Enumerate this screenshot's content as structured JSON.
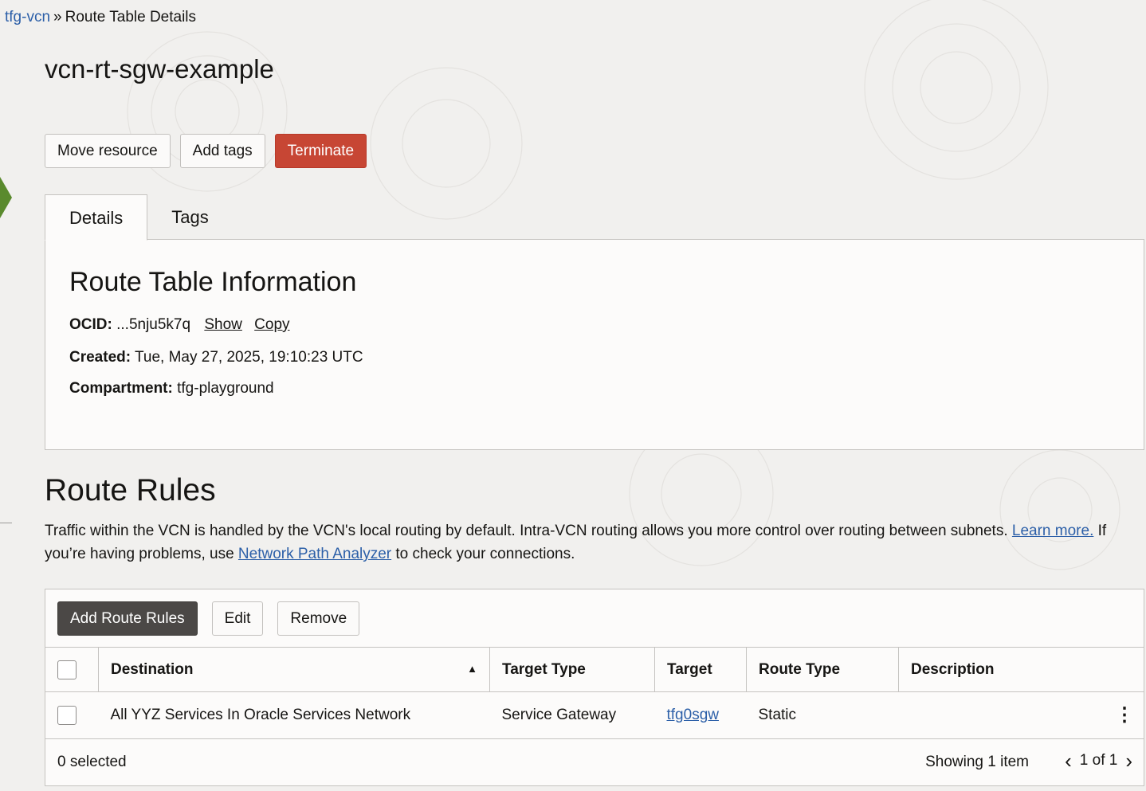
{
  "breadcrumb": {
    "parent": "tfg-vcn",
    "separator": "»",
    "current": "Route Table Details"
  },
  "page": {
    "title": "vcn-rt-sgw-example"
  },
  "actions": {
    "move": "Move resource",
    "add_tags": "Add tags",
    "terminate": "Terminate"
  },
  "tabs": {
    "details": "Details",
    "tags": "Tags"
  },
  "info": {
    "title": "Route Table Information",
    "ocid_label": "OCID:",
    "ocid_value": "...5nju5k7q",
    "show": "Show",
    "copy": "Copy",
    "created_label": "Created:",
    "created_value": "Tue, May 27, 2025, 19:10:23 UTC",
    "compartment_label": "Compartment:",
    "compartment_value": "tfg-playground"
  },
  "rules": {
    "title": "Route Rules",
    "desc_1": "Traffic within the VCN is handled by the VCN's local routing by default. Intra-VCN routing allows you more control over routing between subnets.",
    "learn_more": "Learn more.",
    "desc_2": "If you’re having problems, use",
    "npa_link": "Network Path Analyzer",
    "desc_3": "to check your connections.",
    "toolbar": {
      "add": "Add Route Rules",
      "edit": "Edit",
      "remove": "Remove"
    },
    "columns": {
      "destination": "Destination",
      "target_type": "Target Type",
      "target": "Target",
      "route_type": "Route Type",
      "description": "Description"
    },
    "rows": [
      {
        "destination": "All YYZ Services In Oracle Services Network",
        "target_type": "Service Gateway",
        "target": "tfg0sgw",
        "route_type": "Static",
        "description": ""
      }
    ],
    "footer": {
      "selected": "0 selected",
      "showing": "Showing 1 item",
      "page": "1 of 1"
    }
  },
  "colors": {
    "link": "#2c5fa8",
    "danger": "#c74634",
    "primary_dark": "#4b4846",
    "accent_green": "#5a8a2d"
  },
  "icons": {
    "sort": "sort-ascending-icon",
    "kebab": "kebab-menu-icon",
    "prev": "chevron-left-icon",
    "next": "chevron-right-icon"
  }
}
